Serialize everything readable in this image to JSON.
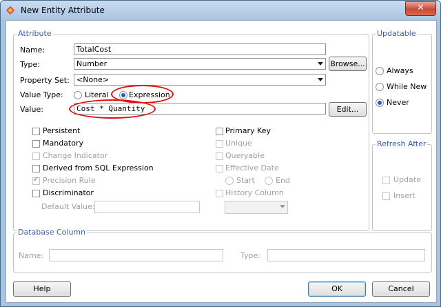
{
  "window": {
    "title": "New Entity Attribute",
    "close_glyph": "✕"
  },
  "attribute": {
    "legend": "Attribute",
    "name_label": "Name:",
    "name_value": "TotalCost",
    "type_label": "Type:",
    "type_value": "Number",
    "browse_label": "Browse...",
    "property_set_label": "Property Set:",
    "property_set_value": "<None>",
    "value_type_label": "Value Type:",
    "literal_label": "Literal",
    "expression_label": "Expression",
    "value_type_selected": "Expression",
    "value_label": "Value:",
    "value_value": "Cost * Quantity",
    "edit_label": "Edit...",
    "checks_left": [
      {
        "label": "Persistent",
        "checked": false,
        "enabled": true
      },
      {
        "label": "Mandatory",
        "checked": false,
        "enabled": true
      },
      {
        "label": "Change Indicator",
        "checked": false,
        "enabled": false
      },
      {
        "label": "Derived from SQL Expression",
        "checked": false,
        "enabled": true
      },
      {
        "label": "Precision Rule",
        "checked": true,
        "enabled": false
      },
      {
        "label": "Discriminator",
        "checked": false,
        "enabled": true
      }
    ],
    "default_value_label": "Default Value:",
    "default_value_value": "",
    "checks_right": [
      {
        "label": "Primary Key",
        "checked": false,
        "enabled": true
      },
      {
        "label": "Unique",
        "checked": false,
        "enabled": false
      },
      {
        "label": "Queryable",
        "checked": false,
        "enabled": false
      },
      {
        "label": "Effective Date",
        "checked": false,
        "enabled": false
      }
    ],
    "start_label": "Start",
    "end_label": "End",
    "history_column_label": "History Column",
    "history_column_value": ""
  },
  "updatable": {
    "legend": "Updatable",
    "options": [
      "Always",
      "While New",
      "Never"
    ],
    "selected": "Never"
  },
  "refresh_after": {
    "legend": "Refresh After",
    "update_label": "Update",
    "insert_label": "Insert"
  },
  "database_column": {
    "legend": "Database Column",
    "name_label": "Name:",
    "name_value": "",
    "type_label": "Type:",
    "type_value": ""
  },
  "buttons": {
    "help": "Help",
    "ok": "OK",
    "cancel": "Cancel"
  },
  "colors": {
    "annotation": "#e01010",
    "legend": "#3b5fa1",
    "titlebar": "#a9c4e2"
  }
}
